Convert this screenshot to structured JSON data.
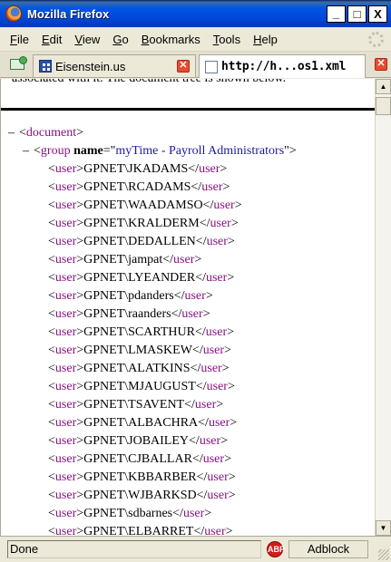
{
  "window": {
    "title": "Mozilla Firefox",
    "buttons": {
      "minimize": "_",
      "maximize": "□",
      "close": "X"
    }
  },
  "menu": [
    {
      "label": "File",
      "accel": "F",
      "rest": "ile"
    },
    {
      "label": "Edit",
      "accel": "E",
      "rest": "dit"
    },
    {
      "label": "View",
      "accel": "V",
      "rest": "iew"
    },
    {
      "label": "Go",
      "accel": "G",
      "rest": "o"
    },
    {
      "label": "Bookmarks",
      "accel": "B",
      "rest": "ookmarks"
    },
    {
      "label": "Tools",
      "accel": "T",
      "rest": "ools"
    },
    {
      "label": "Help",
      "accel": "H",
      "rest": "elp"
    }
  ],
  "tabs": [
    {
      "label": "Eisenstein.us",
      "icon": "grid-favicon",
      "active": false
    },
    {
      "label": "http://h...os1.xml",
      "icon": "page-favicon",
      "active": true
    }
  ],
  "content": {
    "intro_text": "associated with it. The document tree is shown below.",
    "document_tag": "document",
    "group_tag": "group",
    "group_attr_name": "name",
    "group_attr_value": "myTime - Payroll Administrators",
    "user_tag": "user",
    "users": [
      "GPNET\\JKADAMS",
      "GPNET\\RCADAMS",
      "GPNET\\WAADAMSO",
      "GPNET\\KRALDERM",
      "GPNET\\DEDALLEN",
      "GPNET\\jampat",
      "GPNET\\LYEANDER",
      "GPNET\\pdanders",
      "GPNET\\raanders",
      "GPNET\\SCARTHUR",
      "GPNET\\LMASKEW",
      "GPNET\\ALATKINS",
      "GPNET\\MJAUGUST",
      "GPNET\\TSAVENT",
      "GPNET\\ALBACHRA",
      "GPNET\\JOBAILEY",
      "GPNET\\CJBALLAR",
      "GPNET\\KBBARBER",
      "GPNET\\WJBARKSD",
      "GPNET\\sdbarnes",
      "GPNET\\ELBARRET"
    ],
    "collapse_symbol": "–"
  },
  "status": {
    "text": "Done",
    "adblock_label": "Adblock",
    "adblock_icon_text": "ABP"
  }
}
